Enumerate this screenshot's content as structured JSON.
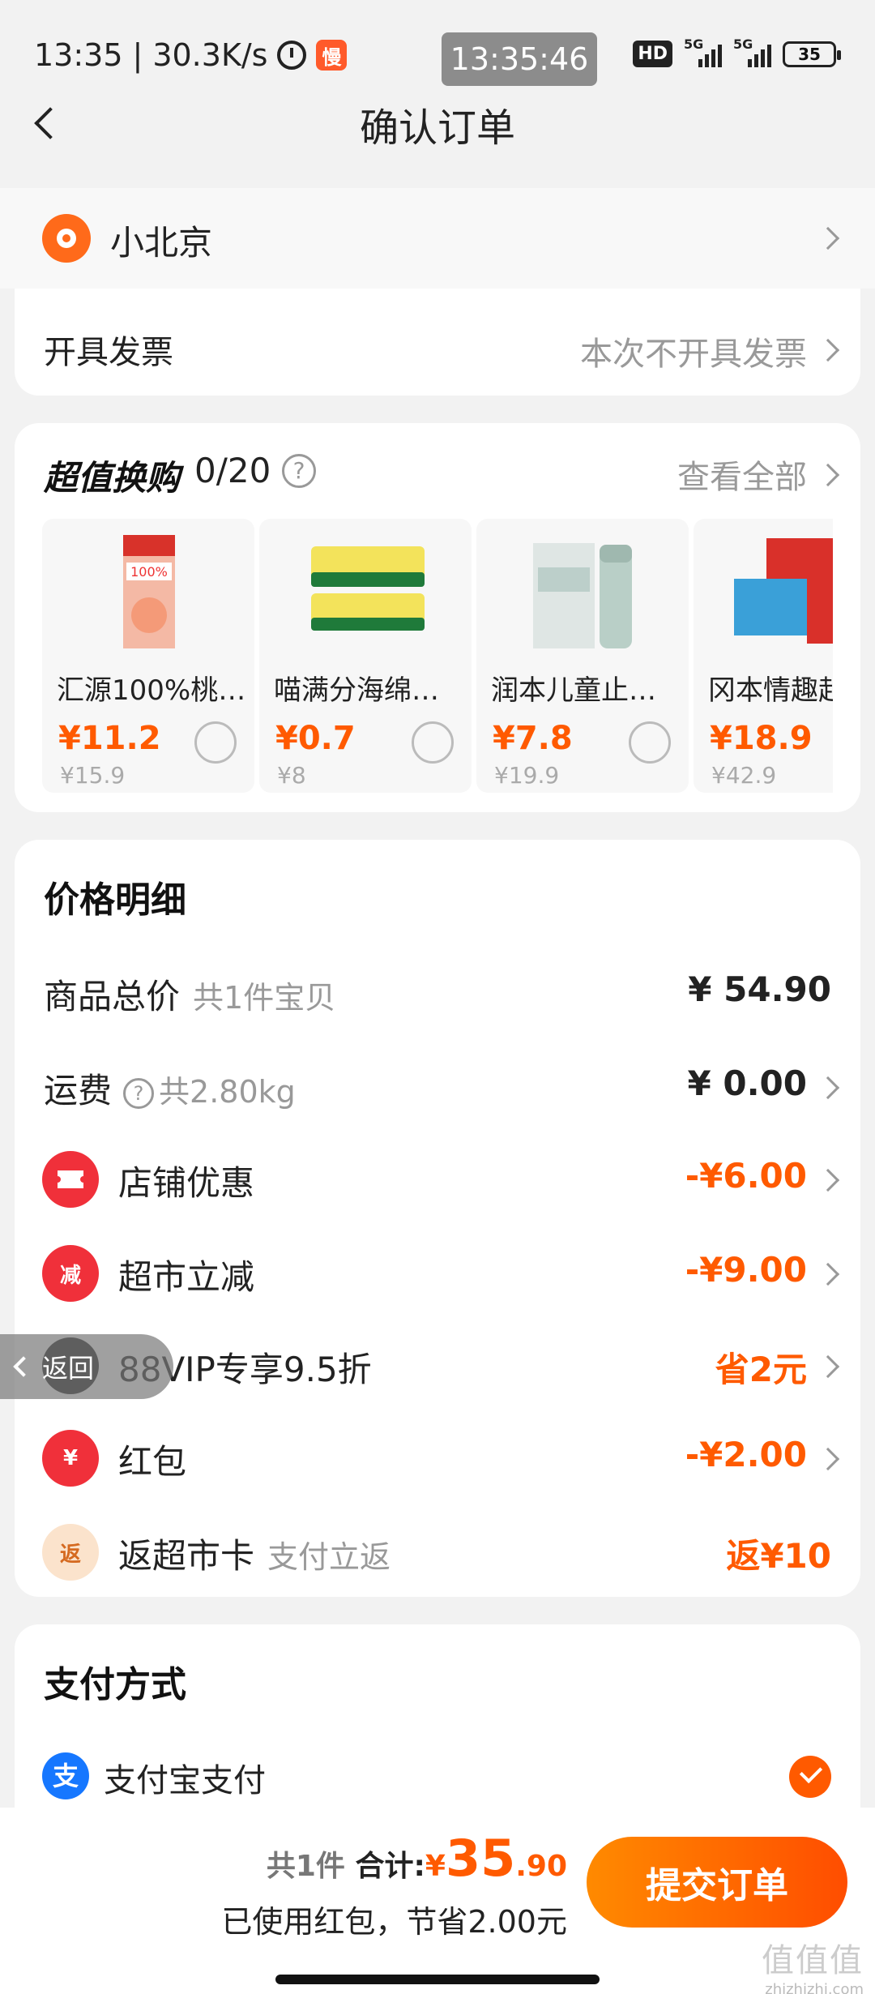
{
  "status_bar": {
    "time": "13:35",
    "net_speed": "30.3K/s",
    "app_badge": "慢",
    "clock_overlay": "13:35:46",
    "hd_label": "HD",
    "signal_label_1": "5G",
    "signal_label_2": "5G",
    "battery": "35"
  },
  "header": {
    "title": "确认订单"
  },
  "address": {
    "name": "小北京"
  },
  "invoice": {
    "label": "开具发票",
    "value": "本次不开具发票"
  },
  "deals": {
    "title": "超值换购",
    "count": "0/20",
    "help": "?",
    "see_all": "查看全部",
    "items": [
      {
        "name": "汇源100%桃…",
        "price": "¥11.2",
        "original": "¥15.9",
        "icon": "juice-box-icon"
      },
      {
        "name": "喵满分海绵…",
        "price": "¥0.7",
        "original": "¥8",
        "icon": "sponge-icon"
      },
      {
        "name": "润本儿童止…",
        "price": "¥7.8",
        "original": "¥19.9",
        "icon": "balm-stick-icon"
      },
      {
        "name": "冈本情趣起",
        "price": "¥18.9",
        "original": "¥42.9",
        "icon": "product-box-icon"
      }
    ]
  },
  "price_detail": {
    "title": "价格明细",
    "goods_total": {
      "label": "商品总价",
      "sub": "共1件宝贝",
      "value": "¥ 54.90"
    },
    "shipping": {
      "label": "运费",
      "sub": "共2.80kg",
      "value": "¥ 0.00"
    },
    "store_discount": {
      "label": "店铺优惠",
      "value": "-¥6.00",
      "icon_text": ""
    },
    "market_cut": {
      "label": "超市立减",
      "value": "-¥9.00",
      "icon_text": "减"
    },
    "vip": {
      "label": "88VIP专享9.5折",
      "value": "省2元"
    },
    "red_packet": {
      "label": "红包",
      "value": "-¥2.00",
      "icon_text": "¥"
    },
    "cashback": {
      "label": "返超市卡",
      "sub": "支付立返",
      "value": "返¥10",
      "icon_text": "返"
    }
  },
  "payment": {
    "title": "支付方式",
    "method": "支付宝支付",
    "icon_text": "支"
  },
  "bottom": {
    "count": "共1件",
    "total_label": "合计:",
    "currency": "¥",
    "total_int": "35",
    "total_dec": ".90",
    "saving": "已使用红包，节省2.00元",
    "submit": "提交订单"
  },
  "float_back": {
    "label": "返回"
  },
  "watermark": {
    "text": "值值值",
    "sub": "zhizhizhi.com"
  },
  "colors": {
    "accent": "#ff5a00",
    "alipay": "#1677ff"
  }
}
